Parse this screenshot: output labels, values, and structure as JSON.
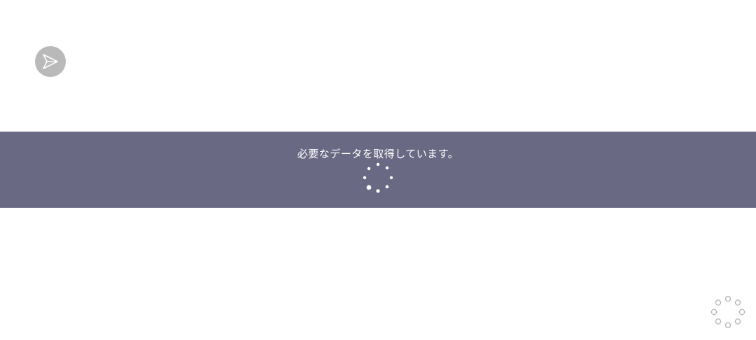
{
  "loading": {
    "message": "必要なデータを取得しています。"
  },
  "colors": {
    "banner_background": "#6a6983",
    "send_button_background": "#b9b9b9",
    "spinner_light": "#ffffff",
    "spinner_outline": "#b5b5b5"
  },
  "icons": {
    "send": "send-icon",
    "banner_spinner": "loading-spinner-icon",
    "corner_spinner": "loading-spinner-icon"
  }
}
